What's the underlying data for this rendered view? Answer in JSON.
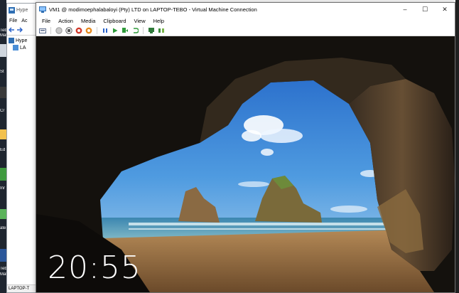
{
  "desktop": {
    "labels": [
      "Teb",
      "Mat",
      "St",
      "Cr",
      "Ed",
      "Inr",
      "ate",
      "W",
      "Teb",
      "Mat"
    ]
  },
  "hyperv_manager": {
    "title": "Hype",
    "menu": [
      "File",
      "Ac"
    ],
    "tree": [
      {
        "label": "Hype"
      },
      {
        "label": "LA"
      }
    ],
    "status": "LAPTOP-T"
  },
  "vm_window": {
    "title": "VM1 @ modimoephalabaloyi (Pty) LTD on LAPTOP-TEBO - Virtual Machine Connection",
    "controls": {
      "minimize": "–",
      "maximize": "☐",
      "close": "✕"
    },
    "menu": [
      "File",
      "Action",
      "Media",
      "Clipboard",
      "View",
      "Help"
    ],
    "toolbar": [
      {
        "icon": "ctrl-alt-del-icon",
        "color": "#5a6b8c"
      },
      {
        "icon": "start-icon",
        "color": "#9a9a9a"
      },
      {
        "icon": "turn-off-icon",
        "color": "#555555"
      },
      {
        "icon": "shutdown-icon",
        "color": "#d13a2b"
      },
      {
        "icon": "save-icon",
        "color": "#e58a1f"
      },
      {
        "icon": "pause-icon",
        "color": "#2a62c9"
      },
      {
        "icon": "resume-icon",
        "color": "#2f9a3a"
      },
      {
        "icon": "reset-icon",
        "color": "#2f9a3a"
      },
      {
        "icon": "revert-icon",
        "color": "#2f9a3a"
      },
      {
        "icon": "checkpoint-icon",
        "color": "#2f7a3a"
      },
      {
        "icon": "enhanced-session-icon",
        "color": "#3a8a3a"
      }
    ]
  },
  "lock_screen": {
    "time": "20:55"
  }
}
